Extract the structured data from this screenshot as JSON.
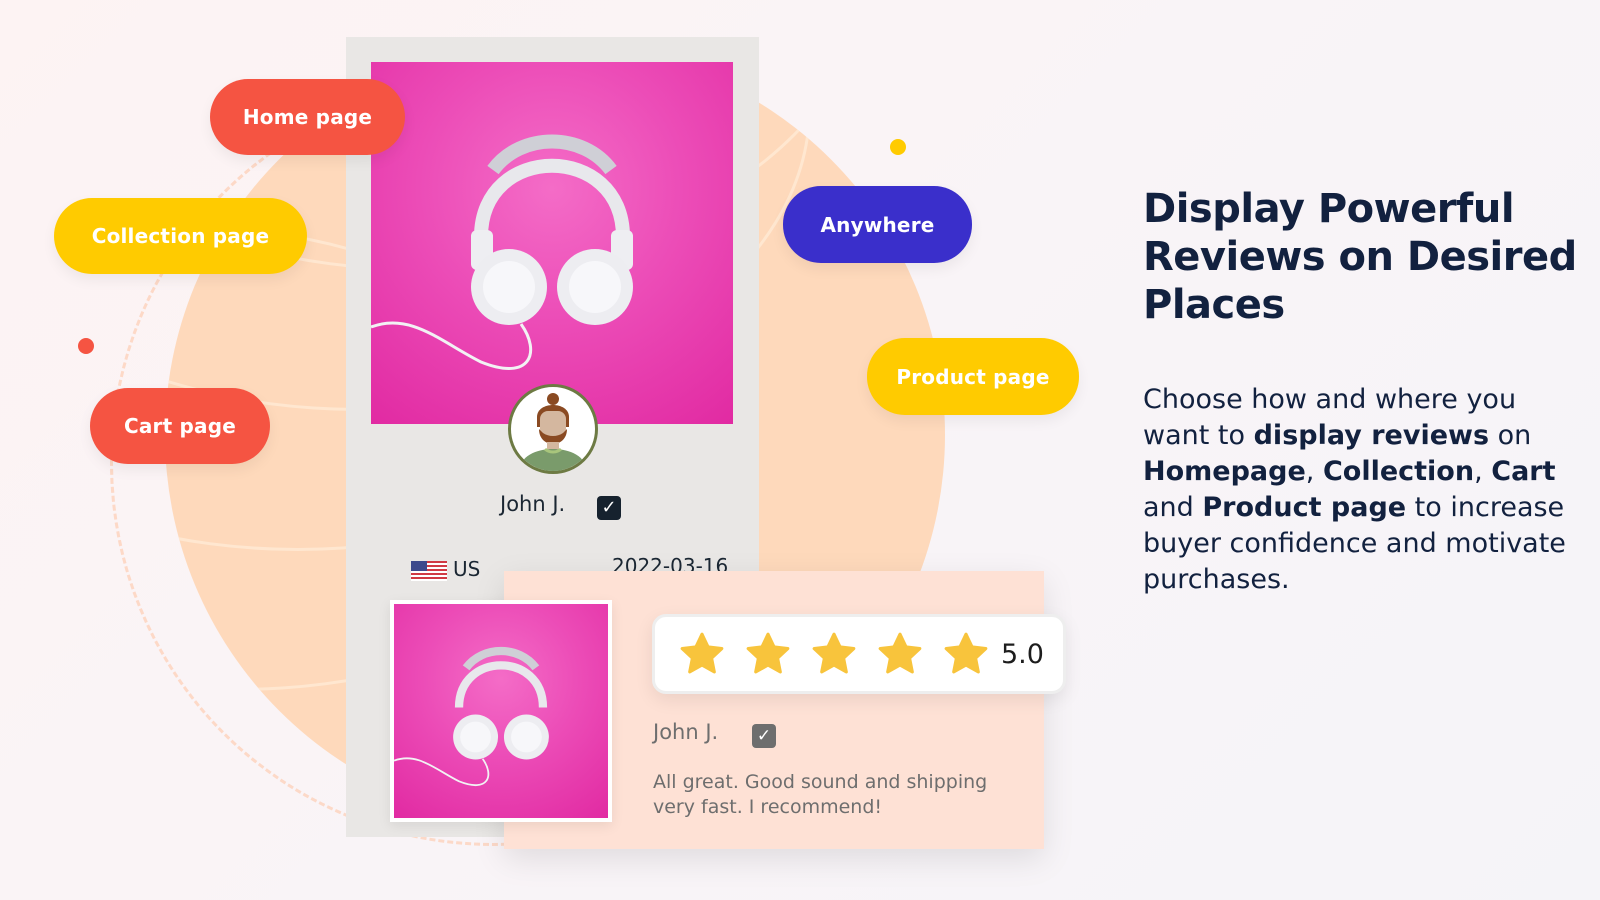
{
  "tags": {
    "home": "Home page",
    "collection": "Collection page",
    "cart": "Cart page",
    "anywhere": "Anywhere",
    "product": "Product page"
  },
  "colors": {
    "coral": "#f55442",
    "yellow": "#ffcb00",
    "indigo": "#3a2fcb",
    "peach": "#fed9bb",
    "navy": "#12213f",
    "star": "#f8c43c",
    "magenta": "#ec4cb7"
  },
  "product_card": {
    "reviewer_name": "John J.",
    "verified_icon": "check-square-icon",
    "country": "US",
    "flag_icon": "us-flag-icon",
    "date": "2022-03-16"
  },
  "review_card": {
    "rating": 5.0,
    "rating_label": "5.0",
    "stars_filled": 5,
    "stars_total": 5,
    "reviewer_name": "John J.",
    "text": "All great. Good sound and shipping very fast. I recommend!"
  },
  "hero": {
    "headline": "Display Powerful Reviews on Desired Places",
    "desc_parts": [
      {
        "t": "Choose how and where you want to ",
        "b": false
      },
      {
        "t": "display reviews",
        "b": true
      },
      {
        "t": " on ",
        "b": false
      },
      {
        "t": "Homepage",
        "b": true
      },
      {
        "t": ", ",
        "b": false
      },
      {
        "t": "Collection",
        "b": true
      },
      {
        "t": ", ",
        "b": false
      },
      {
        "t": "Cart",
        "b": true
      },
      {
        "t": " and ",
        "b": false
      },
      {
        "t": "Product page",
        "b": true
      },
      {
        "t": " to increase buyer confidence and motivate purchases.",
        "b": false
      }
    ]
  }
}
